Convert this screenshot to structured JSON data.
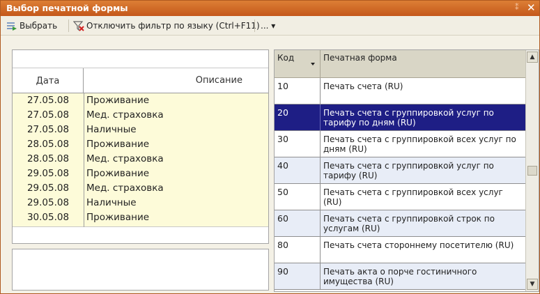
{
  "window": {
    "title": "Выбор печатной формы",
    "pin_glyph": "⁑",
    "close_glyph": "✕"
  },
  "toolbar": {
    "select_label": "Выбрать",
    "filter_label": "Отключить фильтр по языку (Ctrl+F11)",
    "more_label": "... ▾"
  },
  "left_table": {
    "columns": {
      "date": "Дата",
      "description": "Описание"
    },
    "rows": [
      {
        "date": "27.05.08",
        "description": "Проживание"
      },
      {
        "date": "27.05.08",
        "description": "Мед. страховка"
      },
      {
        "date": "27.05.08",
        "description": "Наличные"
      },
      {
        "date": "28.05.08",
        "description": "Проживание"
      },
      {
        "date": "28.05.08",
        "description": "Мед. страховка"
      },
      {
        "date": "29.05.08",
        "description": "Проживание"
      },
      {
        "date": "29.05.08",
        "description": "Мед. страховка"
      },
      {
        "date": "29.05.08",
        "description": "Наличные"
      },
      {
        "date": "30.05.08",
        "description": "Проживание"
      }
    ]
  },
  "right_table": {
    "columns": {
      "code": "Код",
      "form": "Печатная форма"
    },
    "rows": [
      {
        "code": "10",
        "form": "Печать счета (RU)"
      },
      {
        "code": "20",
        "form": "Печать счета с группировкой услуг по тарифу по дням (RU)"
      },
      {
        "code": "30",
        "form": "Печать счета с группировкой всех услуг по дням (RU)"
      },
      {
        "code": "40",
        "form": "Печать счета с группировкой услуг по тарифу (RU)"
      },
      {
        "code": "50",
        "form": "Печать счета с группировкой всех услуг (RU)"
      },
      {
        "code": "60",
        "form": "Печать счета с группировкой строк по услугам (RU)"
      },
      {
        "code": "80",
        "form": "Печать счета стороннему посетителю (RU)"
      },
      {
        "code": "90",
        "form": "Печать акта о порче гостиничного имущества (RU)"
      }
    ],
    "selected_code": "20"
  },
  "colors": {
    "titlebar": "#c4581b",
    "selection": "#1e1e85",
    "highlight_rows": "#fdfbd9",
    "alt_rows": "#e8edf7"
  }
}
